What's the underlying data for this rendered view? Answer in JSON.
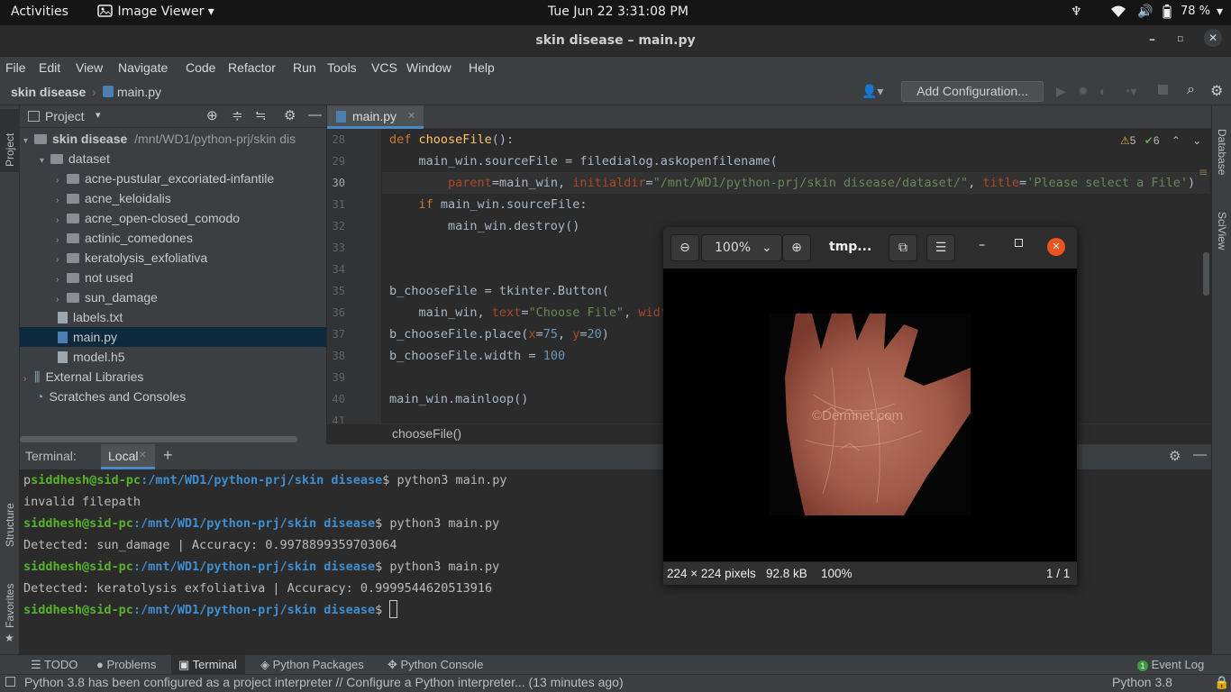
{
  "gnome": {
    "activities": "Activities",
    "app": "Image Viewer",
    "clock": "Tue Jun 22  3:31:08 PM",
    "battery": "78 %"
  },
  "window": {
    "title": "skin disease – main.py"
  },
  "menu": [
    "File",
    "Edit",
    "View",
    "Navigate",
    "Code",
    "Refactor",
    "Run",
    "Tools",
    "VCS",
    "Window",
    "Help"
  ],
  "nav": {
    "project": "skin disease",
    "file": "main.py",
    "add_config": "Add Configuration..."
  },
  "project_panel": {
    "title": "Project",
    "root": "skin disease",
    "root_path": "/mnt/WD1/python-prj/skin dis",
    "items": [
      "dataset",
      "acne-pustular_excoriated-infantile",
      "acne_keloidalis",
      "acne_open-closed_comodo",
      "actinic_comedones",
      "keratolysis_exfoliativa",
      "not used",
      "sun_damage",
      "labels.txt",
      "main.py",
      "model.h5",
      "External Libraries",
      "Scratches and Consoles"
    ]
  },
  "editor": {
    "tab": "main.py",
    "warnings": "5",
    "weak": "6",
    "breadcrumb": "chooseFile()",
    "line_numbers": [
      "28",
      "29",
      "30",
      "31",
      "32",
      "33",
      "34",
      "35",
      "36",
      "37",
      "38",
      "39",
      "40",
      "41"
    ]
  },
  "left_stripe": {
    "project": "Project",
    "structure": "Structure",
    "favorites": "Favorites"
  },
  "right_stripe": {
    "database": "Database",
    "sciview": "SciView"
  },
  "terminal": {
    "label": "Terminal:",
    "tab": "Local",
    "user": "siddhesh@sid-pc",
    "path": ":/mnt/WD1/python-prj/skin disease",
    "cmd": "$ python3 main.py",
    "out1": "invalid filepath",
    "out2": "Detected: sun_damage | Accuracy: 0.9978899359703064",
    "out3": "Detected: keratolysis exfoliativa | Accuracy: 0.9999544620513916",
    "first_prefix": "p"
  },
  "toolwindows": {
    "todo": "TODO",
    "problems": "Problems",
    "terminal": "Terminal",
    "packages": "Python Packages",
    "console": "Python Console",
    "eventlog": "Event Log",
    "eventcount": "1"
  },
  "status": {
    "message": "Python 3.8 has been configured as a project interpreter // Configure a Python interpreter... (13 minutes ago)",
    "interpreter": "Python 3.8"
  },
  "viewer": {
    "zoom": "100%",
    "title": "tmp...",
    "dims": "224 × 224 pixels",
    "size": "92.8 kB",
    "zoom2": "100%",
    "page": "1 / 1",
    "watermark": "©Dermnet.com"
  }
}
